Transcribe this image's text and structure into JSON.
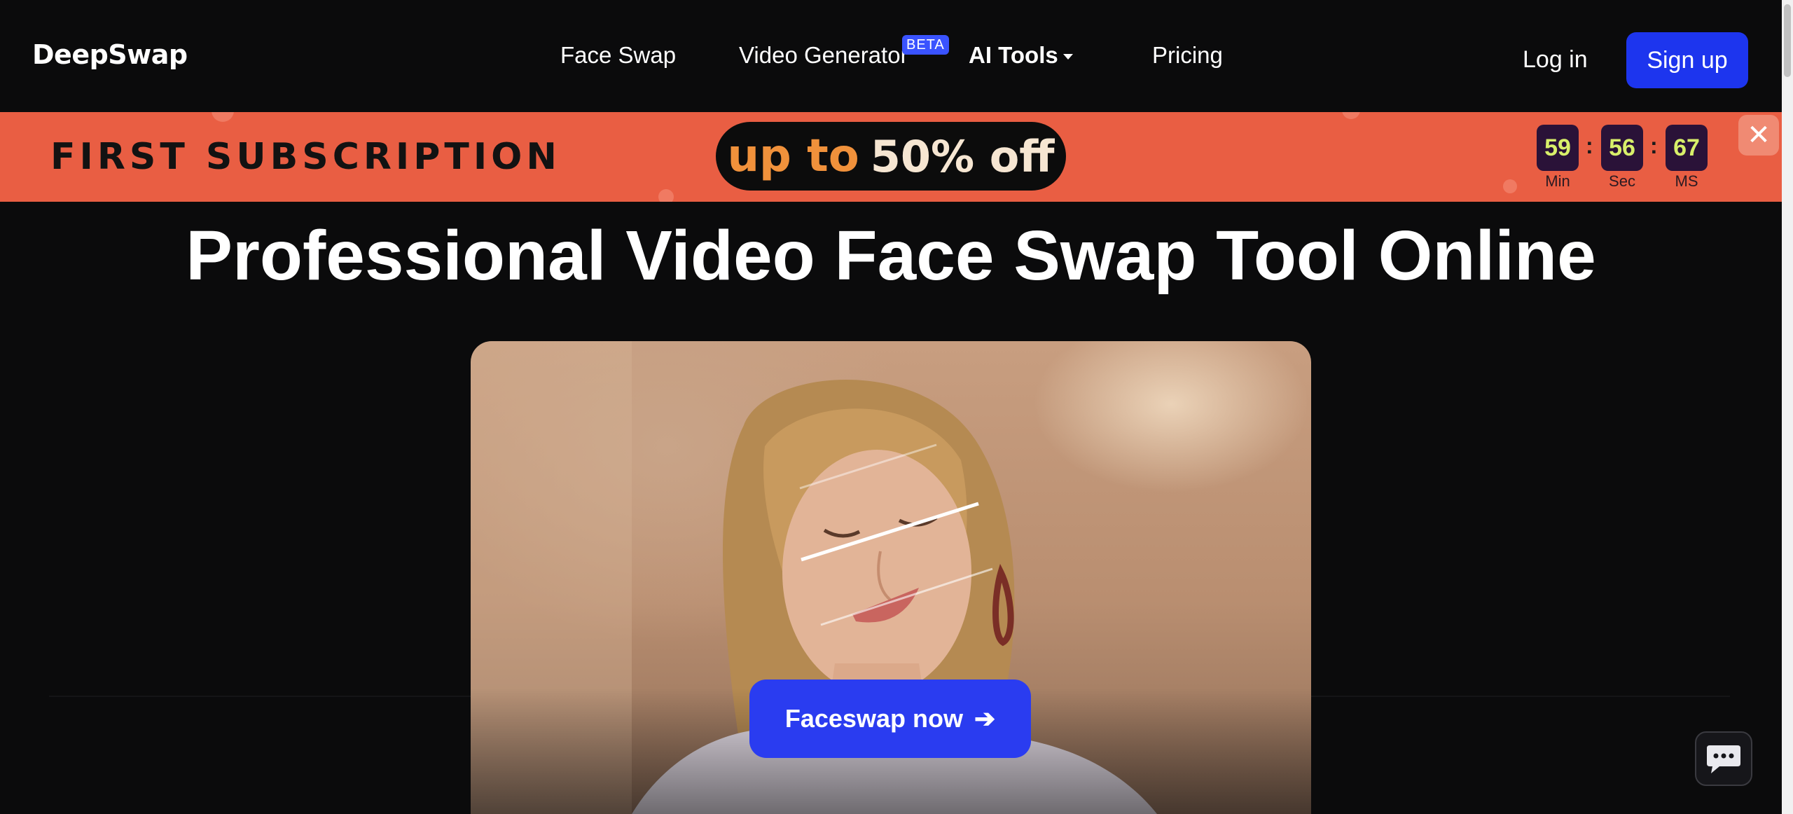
{
  "header": {
    "logo": "DeepSwap",
    "nav": {
      "face_swap": "Face Swap",
      "video_generator": "Video Generator",
      "video_generator_badge": "BETA",
      "ai_tools": "AI Tools",
      "pricing": "Pricing"
    },
    "login": "Log in",
    "signup": "Sign up"
  },
  "promo": {
    "title": "FIRST SUBSCRIPTION",
    "offer_prefix": "up to",
    "offer_value": "50% off",
    "timer": {
      "minutes": "59",
      "seconds": "56",
      "ms": "67",
      "minutes_label": "Min",
      "seconds_label": "Sec",
      "ms_label": "MS",
      "separator": ":"
    },
    "close": "✕"
  },
  "hero": {
    "title": "Professional Video Face Swap Tool Online",
    "cta": "Faceswap now",
    "cta_arrow": "➔"
  },
  "colors": {
    "background": "#0b0b0c",
    "primary_button": "#1d35ee",
    "promo_banner": "#e95e43",
    "offer_orange": "#f0913b",
    "timer_digits": "#d8ef6a"
  },
  "icons": {
    "dropdown": "caret-down-icon",
    "close": "close-icon",
    "cta": "arrow-right-icon",
    "chat": "chat-icon"
  }
}
